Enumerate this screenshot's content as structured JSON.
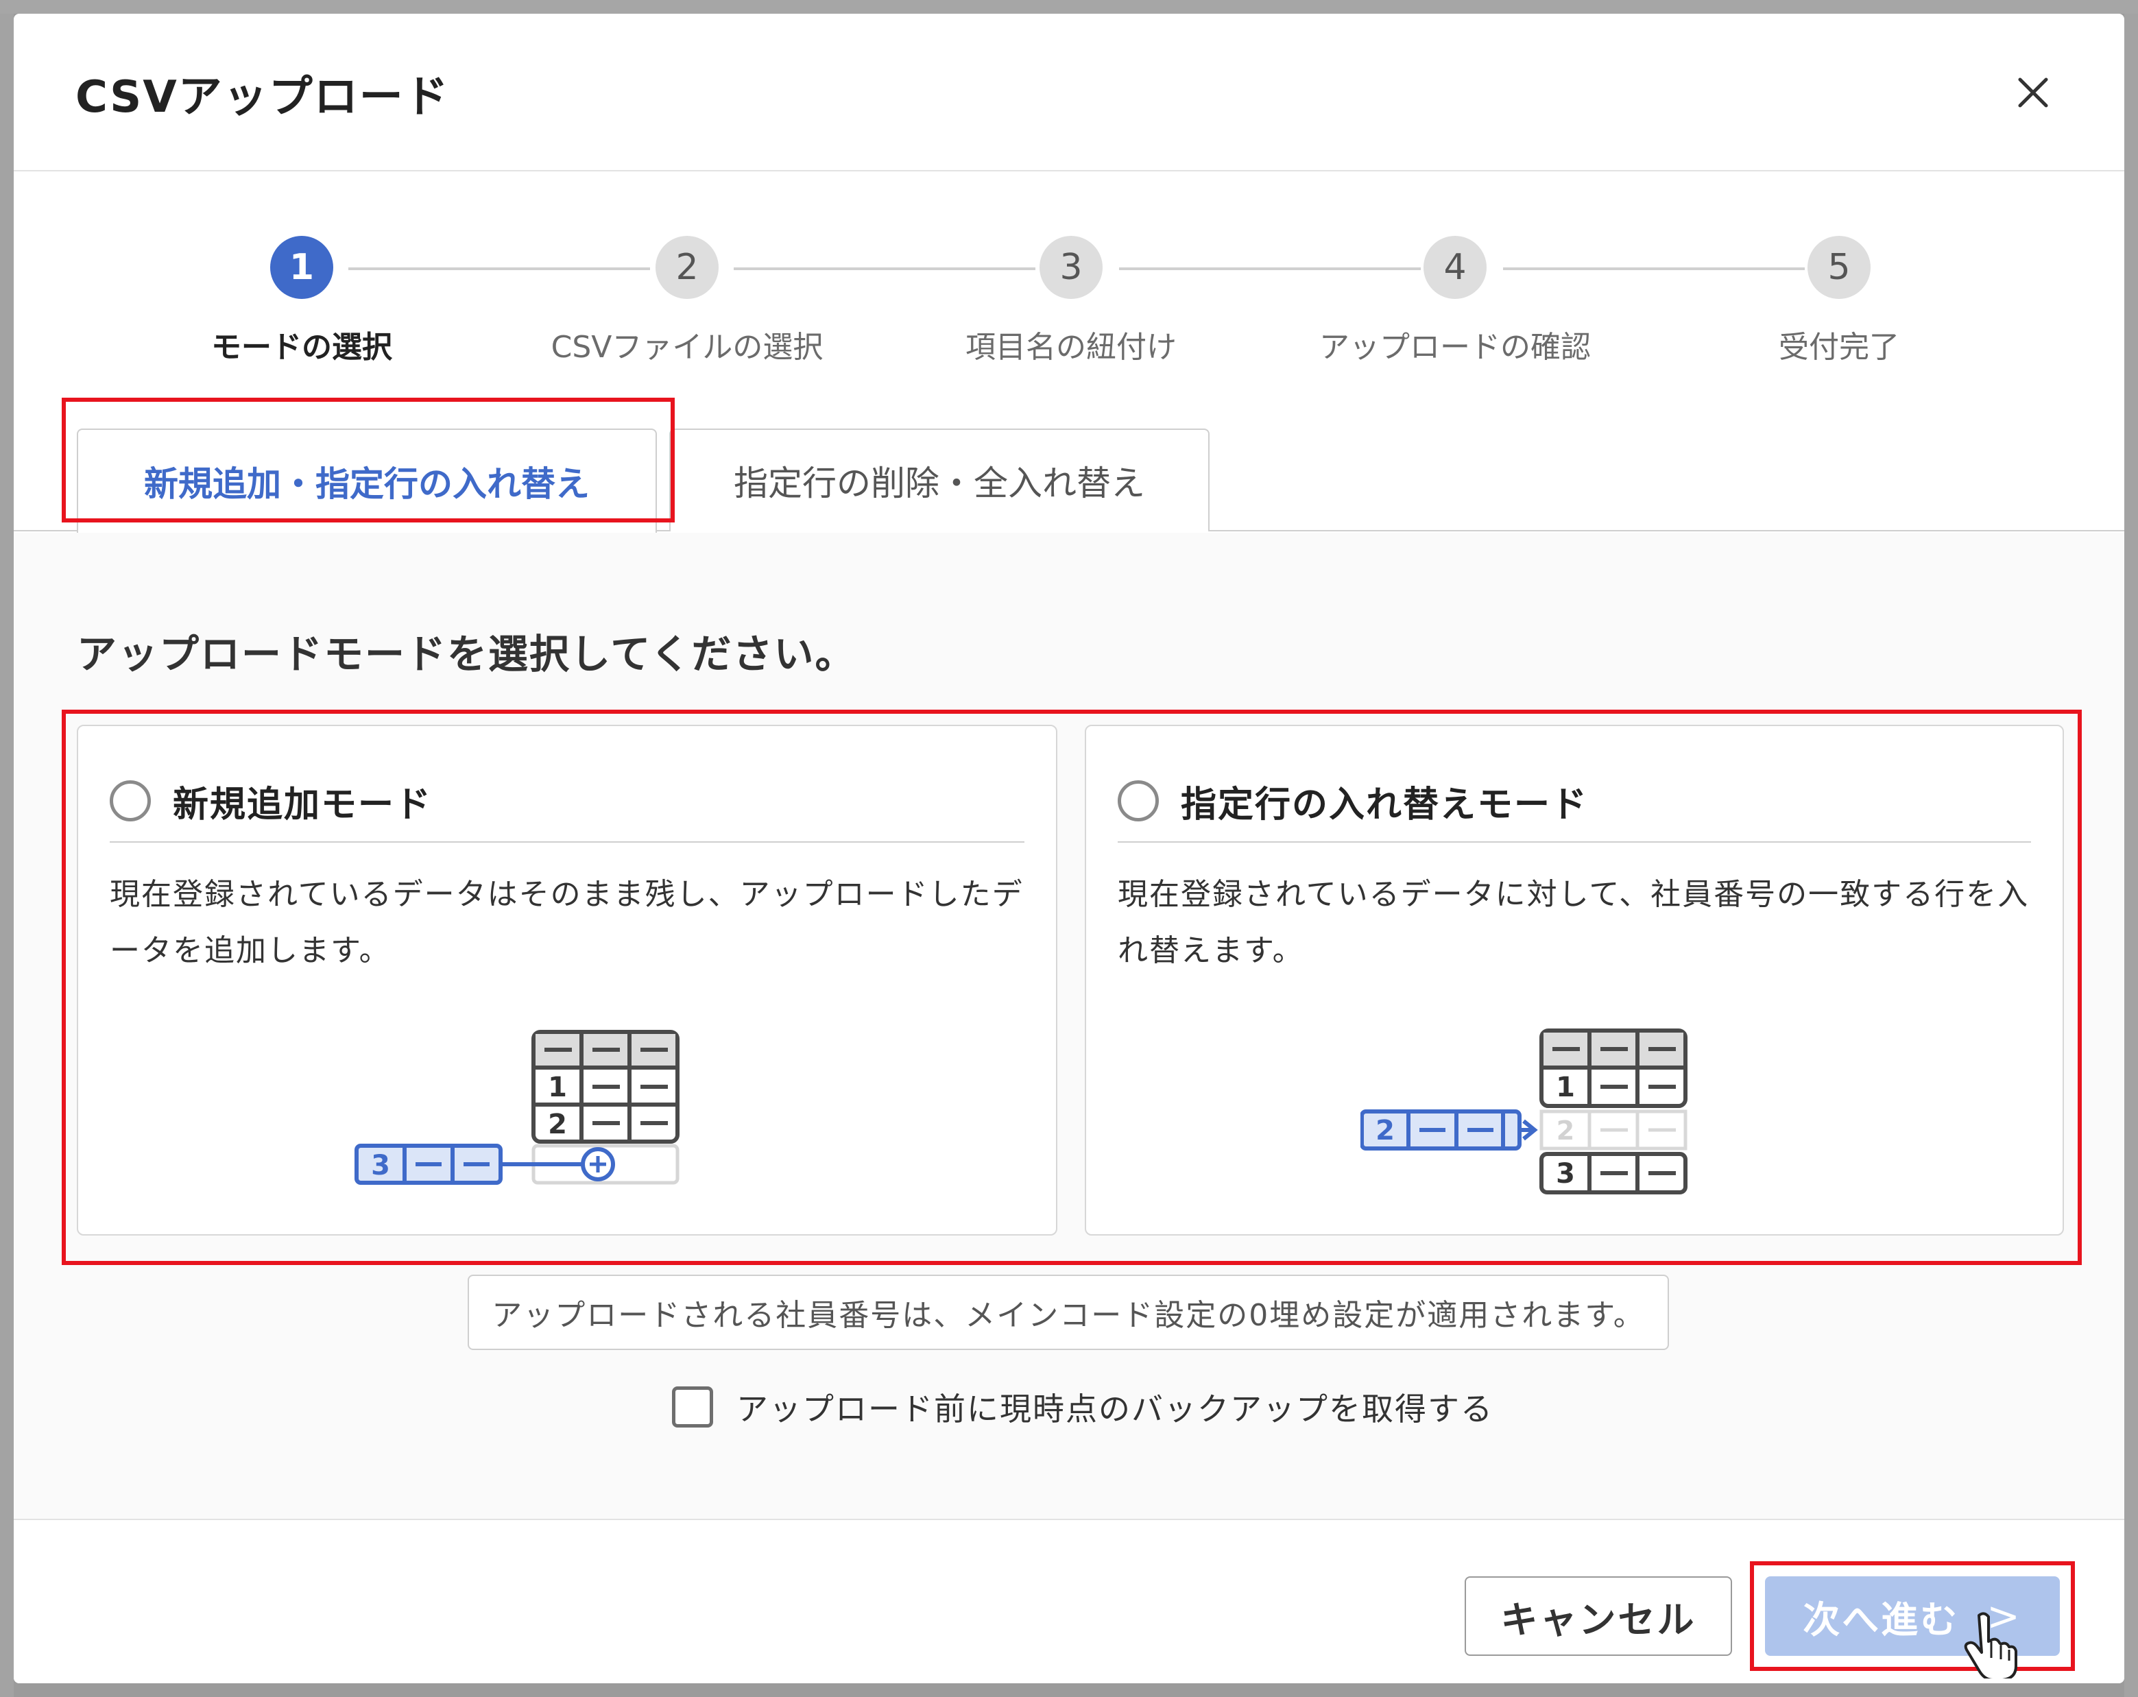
{
  "modal": {
    "title": "CSVアップロード",
    "close_icon": "close-icon"
  },
  "stepper": {
    "steps": [
      {
        "number": "1",
        "label": "モードの選択",
        "state": "active"
      },
      {
        "number": "2",
        "label": "CSVファイルの選択",
        "state": "upcoming"
      },
      {
        "number": "3",
        "label": "項目名の紐付け",
        "state": "upcoming"
      },
      {
        "number": "4",
        "label": "アップロードの確認",
        "state": "upcoming"
      },
      {
        "number": "5",
        "label": "受付完了",
        "state": "upcoming"
      }
    ]
  },
  "tabs": [
    {
      "label": "新規追加・指定行の入れ替え",
      "selected": true
    },
    {
      "label": "指定行の削除・全入れ替え",
      "selected": false
    }
  ],
  "prompt": "アップロードモードを選択してください。",
  "modes": [
    {
      "title": "新規追加モード",
      "description": "現在登録されているデータはそのまま残し、アップロードしたデータを追加します。",
      "selected": false,
      "illustration": {
        "rows": [
          "1",
          "2"
        ],
        "new_row": "3"
      }
    },
    {
      "title": "指定行の入れ替えモード",
      "description": "現在登録されているデータに対して、社員番号の一致する行を入れ替えます。",
      "selected": false,
      "illustration": {
        "rows": [
          "1",
          "2",
          "3"
        ],
        "replacing_row": "2"
      }
    }
  ],
  "notice": "アップロードされる社員番号は、メインコード設定の0埋め設定が適用されます。",
  "backup": {
    "label": "アップロード前に現時点のバックアップを取得する",
    "checked": false
  },
  "footer": {
    "cancel_label": "キャンセル",
    "next_label": "次へ進む",
    "next_icon": "chevron-right-icon",
    "next_enabled": false
  },
  "colors": {
    "accent": "#3f6ac9",
    "highlight": "#e8141e",
    "next_disabled": "#aec4ec"
  }
}
